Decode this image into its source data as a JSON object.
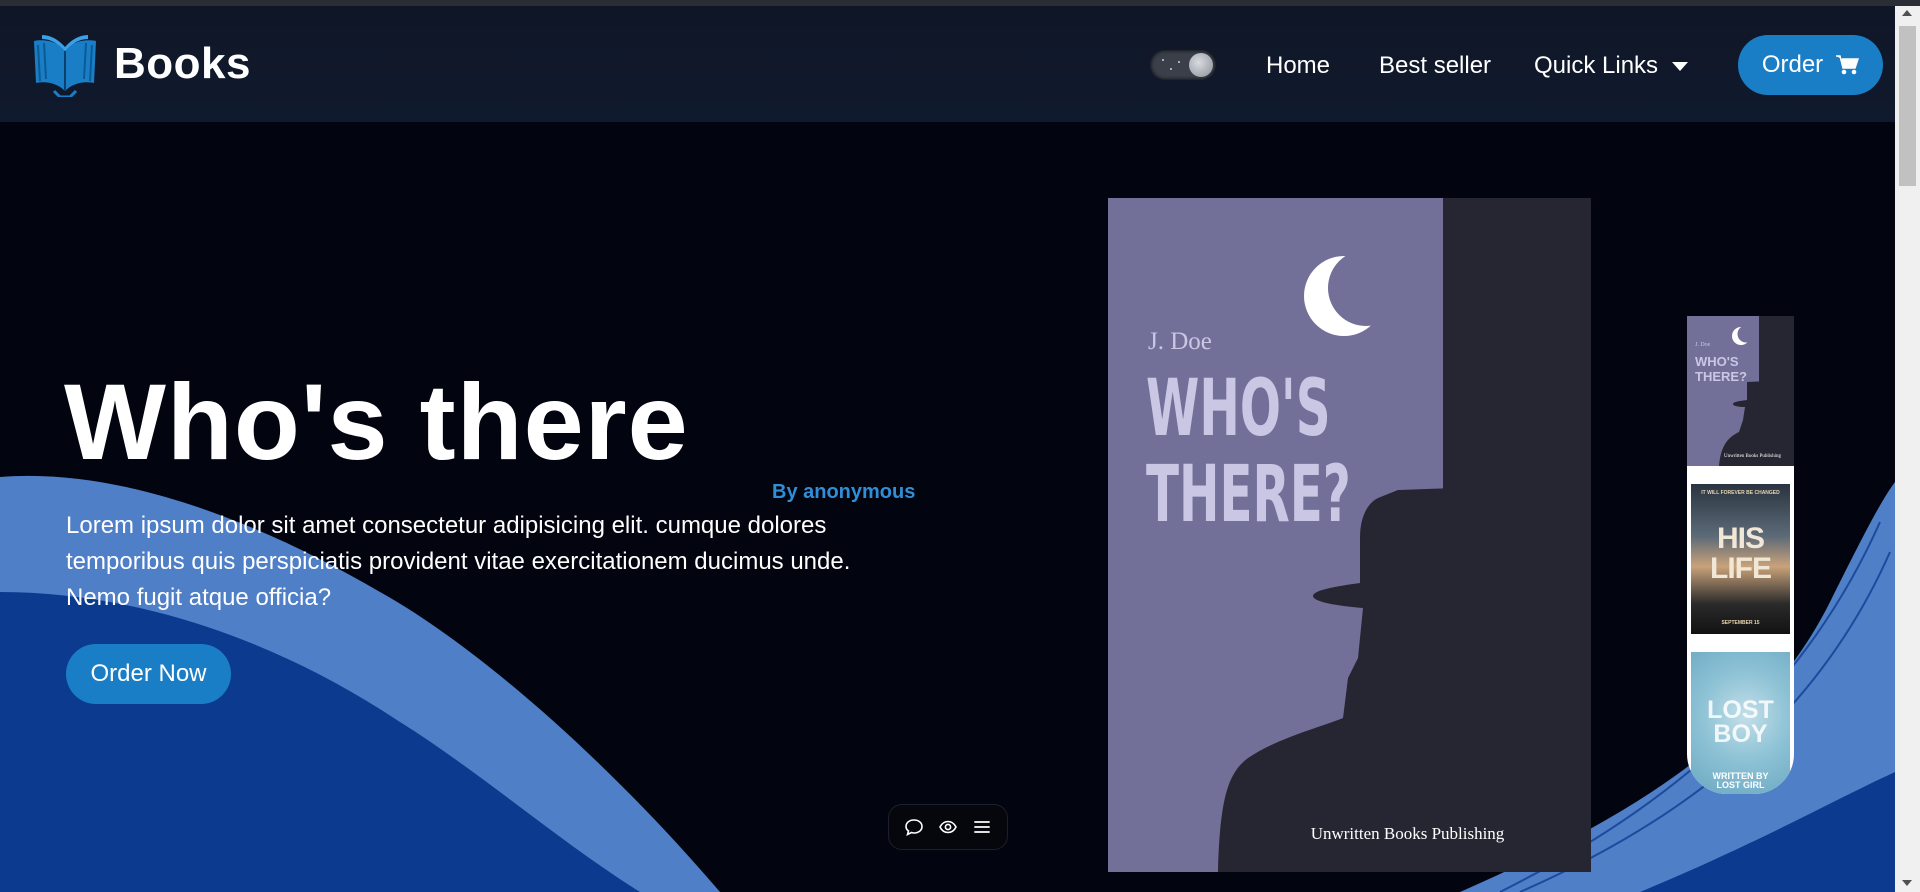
{
  "navbar": {
    "brand": "Books",
    "links": [
      "Home",
      "Best seller",
      "Quick Links"
    ],
    "order_label": "Order",
    "icons": {
      "logo": "open-book-icon",
      "cart": "cart-icon",
      "toggle": "theme-toggle"
    }
  },
  "hero": {
    "title": "Who's there",
    "author": "By anonymous",
    "description": "Lorem ipsum dolor sit amet consectetur adipisicing elit. cumque dolores temporibus quis perspiciatis provident vitae exercitationem ducimus unde. Nemo fugit atque officia?",
    "cta": "Order Now"
  },
  "featured_cover": {
    "author": "J. Doe",
    "title_line1": "WHO'S",
    "title_line2": "THERE?",
    "publisher": "Unwritten Books Publishing"
  },
  "thumbnails": [
    {
      "author": "J. Doe",
      "line1": "WHO'S",
      "line2": "THERE?",
      "footer": "Unwritten Books Publishing"
    },
    {
      "tagline": "IT WILL FOREVER BE CHANGED",
      "line1": "HIS",
      "line2": "LIFE",
      "footer": "SEPTEMBER 15"
    },
    {
      "line1": "LOST",
      "line2": "BOY",
      "footer1": "WRITTEN BY",
      "footer2": "LOST GIRL"
    }
  ],
  "toolbar": {
    "icons": [
      "chat-icon",
      "eye-icon",
      "menu-icon"
    ]
  },
  "colors": {
    "accent": "#1a7ec6",
    "background": "#02050f",
    "navbar": "#0f1626",
    "wave_light": "#4f7fc7",
    "wave_dark": "#0b3a8f",
    "cover": "#727099"
  }
}
